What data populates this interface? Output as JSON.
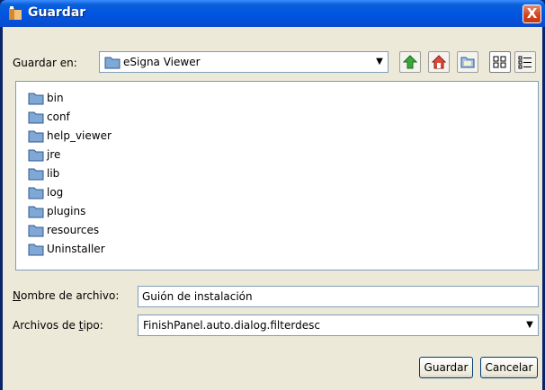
{
  "window": {
    "title": "Guardar",
    "close_label": "X"
  },
  "toolbar": {
    "save_in_label": "Guardar en:",
    "location_value": "eSigna Viewer",
    "buttons": [
      {
        "name": "up-one-level",
        "icon": "up-arrow-icon"
      },
      {
        "name": "home",
        "icon": "home-icon"
      },
      {
        "name": "new-folder",
        "icon": "new-folder-icon"
      },
      {
        "name": "list-view",
        "icon": "list-view-icon"
      },
      {
        "name": "details-view",
        "icon": "details-view-icon"
      }
    ]
  },
  "files": {
    "items": [
      {
        "label": "bin",
        "icon": "folder-icon"
      },
      {
        "label": "conf",
        "icon": "folder-icon"
      },
      {
        "label": "help_viewer",
        "icon": "folder-icon"
      },
      {
        "label": "jre",
        "icon": "folder-icon"
      },
      {
        "label": "lib",
        "icon": "folder-icon"
      },
      {
        "label": "log",
        "icon": "folder-icon"
      },
      {
        "label": "plugins",
        "icon": "folder-icon"
      },
      {
        "label": "resources",
        "icon": "folder-icon"
      },
      {
        "label": "Uninstaller",
        "icon": "folder-icon"
      }
    ]
  },
  "form": {
    "filename_label_mnemonic": "N",
    "filename_label_rest": "ombre de archivo:",
    "filename_value": "Guión de instalación",
    "filetype_label_pre": "Archivos de ",
    "filetype_label_mnemonic": "t",
    "filetype_label_rest": "ipo:",
    "filetype_value": "FinishPanel.auto.dialog.filterdesc"
  },
  "actions": {
    "save_label": "Guardar",
    "cancel_label": "Cancelar"
  },
  "colors": {
    "titlebar": "#0054e3",
    "dialog_bg": "#ece9d8",
    "folder_fill": "#7fa8d6",
    "border": "#7f9db9"
  }
}
